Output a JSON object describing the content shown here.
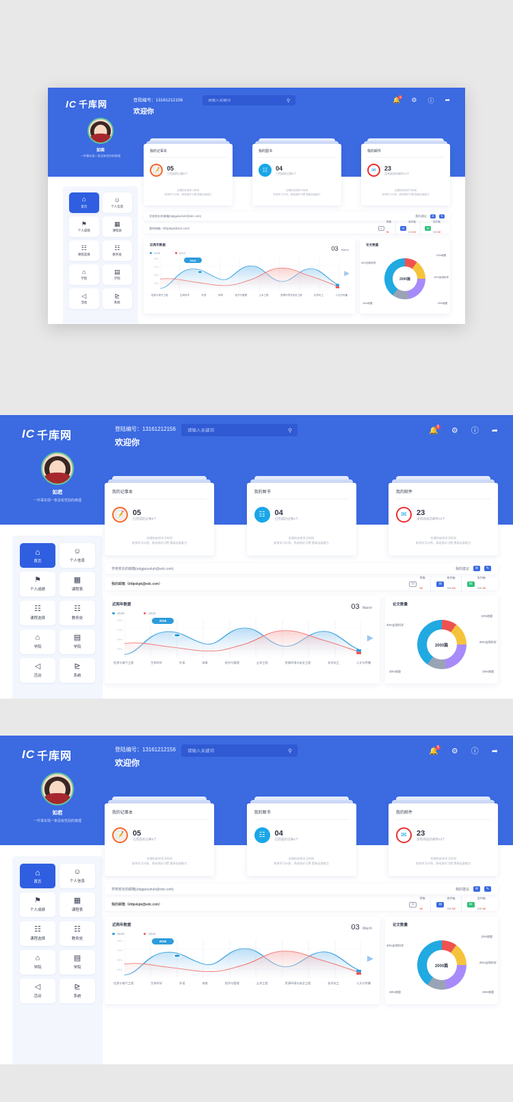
{
  "header": {
    "logo_mark": "IC",
    "logo_text": "千库网",
    "account_line": "登陆编号：13161212156",
    "welcome": "欢迎你",
    "search_placeholder": "请输入关键词",
    "search_value": "",
    "search_icon": "search-icon",
    "icons": [
      {
        "name": "bell-icon",
        "glyph": "☑",
        "badge": "1"
      },
      {
        "name": "gear-icon",
        "glyph": "⚙",
        "badge": ""
      },
      {
        "name": "help-icon",
        "glyph": "?",
        "badge": ""
      },
      {
        "name": "logout-icon",
        "glyph": "↦",
        "badge": ""
      }
    ]
  },
  "profile": {
    "name": "如君",
    "motto": "一件事实现一条没有性别的离理"
  },
  "sidebar": {
    "items": [
      {
        "label": "首页",
        "icon": "home-icon",
        "glyph": "⌂",
        "active": true
      },
      {
        "label": "个人信息",
        "icon": "user-icon",
        "glyph": "○",
        "active": false
      },
      {
        "label": "个人成绩",
        "icon": "trophy-icon",
        "glyph": "⚇",
        "active": false
      },
      {
        "label": "课程表",
        "icon": "calendar-icon",
        "glyph": "▦",
        "active": false
      },
      {
        "label": "课程选择",
        "icon": "books-icon",
        "glyph": "☷",
        "active": false
      },
      {
        "label": "教务处",
        "icon": "open-book-icon",
        "glyph": "☷",
        "active": false
      },
      {
        "label": "学院",
        "icon": "bank-icon",
        "glyph": "⌂",
        "active": false
      },
      {
        "label": "学院",
        "icon": "building-icon",
        "glyph": "▤",
        "active": false
      },
      {
        "label": "活动",
        "icon": "megaphone-icon",
        "glyph": "◁",
        "active": false
      },
      {
        "label": "系统",
        "icon": "grid-icon",
        "glyph": "∷",
        "active": false
      }
    ]
  },
  "cards": [
    {
      "title": "我的记事本",
      "icon": "notebook-icon",
      "icon_color": "#f1682c",
      "number": "05",
      "subtitle": "已完成的记事5个",
      "desc_line1": "合理的安排学习时间",
      "desc_line2": "安排学习计划，养成良好习惯 提高自身能力"
    },
    {
      "title": "我的图书",
      "icon": "books-icon",
      "icon_color": "#1aa6e8",
      "number": "04",
      "subtitle": "已完成的记事4个",
      "desc_line1": "合理的安排学习时间",
      "desc_line2": "安排学习计划，养成良好习惯 提高自身能力"
    },
    {
      "title": "我的邮件",
      "icon": "mail-icon",
      "icon_color": "#e8302f",
      "number": "23",
      "subtitle": "没有阅读的邮件23个",
      "desc_line1": "合理的安排学习时间",
      "desc_line2": "安排学习计划，养成良好习惯 提高自身能力"
    }
  ],
  "mailbar": {
    "principal_label": "学校校长的邮箱(sdgguisuhuh@edc.com)",
    "suggestion_label": "我的建议",
    "suggestion_icons": [
      "envelope-icon",
      "chat-icon"
    ]
  },
  "mailbar2": {
    "my_mail_label": "我的邮箱（kfdpokpk@edc.com）",
    "stats": [
      {
        "icon": "draft-envelope-icon",
        "label": "草稿",
        "count": "",
        "badge": "01",
        "color": "#9aa1b1"
      },
      {
        "icon": "inbox-envelope-icon",
        "label": "收件箱",
        "count": "210",
        "badge": "02",
        "color": "#3b6ae1"
      },
      {
        "icon": "outbox-envelope-icon",
        "label": "发件箱",
        "count": "210",
        "badge": "02",
        "color": "#2fc07a"
      }
    ]
  },
  "chart_data": [
    {
      "type": "line",
      "title": "近两年数据",
      "date_day": "03",
      "date_month": "March",
      "legend": [
        "2018",
        "2019"
      ],
      "legend_colors": [
        "#2d9cdb",
        "#ef5350"
      ],
      "legend_position": "top-left",
      "grid": true,
      "ylabel": "",
      "xlabel": "",
      "ytick_labels": [
        "98%",
        "97%",
        "96%",
        "95%"
      ],
      "ylim": [
        94.5,
        98.5
      ],
      "categories": [
        "信息与电气工程",
        "生命科学",
        "外语",
        "体育",
        "经济与管理",
        "土木工程",
        "资源环境与安全工程",
        "化学化工",
        "人文与传播"
      ],
      "series": [
        {
          "name": "2018",
          "color": "#2d9cdb",
          "values": [
            95.0,
            97.3,
            96.6,
            95.5,
            97.6,
            95.6,
            95.6,
            97.5,
            95.3
          ]
        },
        {
          "name": "2019",
          "color": "#ef5350",
          "values": [
            96.1,
            95.9,
            95.4,
            95.3,
            95.9,
            97.0,
            96.3,
            95.6,
            95.1
          ]
        }
      ],
      "highlight_tag": "2018",
      "highlight_point": {
        "series": "2018",
        "category": "生命科学",
        "value": 96.6
      }
    },
    {
      "type": "pie",
      "title": "论文数量",
      "center_label": "2000篇",
      "labels": [
        "10%地理",
        "25%自然科学",
        "25%地理",
        "25%地理",
        "40%自然科学"
      ],
      "values": [
        10,
        25,
        25,
        25,
        40
      ],
      "colors": [
        "#ef5350",
        "#f5c33b",
        "#a78bfa",
        "#9aa3b5",
        "#21a9e1"
      ],
      "label_positions": [
        "top-right",
        "right",
        "bottom-right",
        "bottom-left",
        "left"
      ]
    }
  ]
}
